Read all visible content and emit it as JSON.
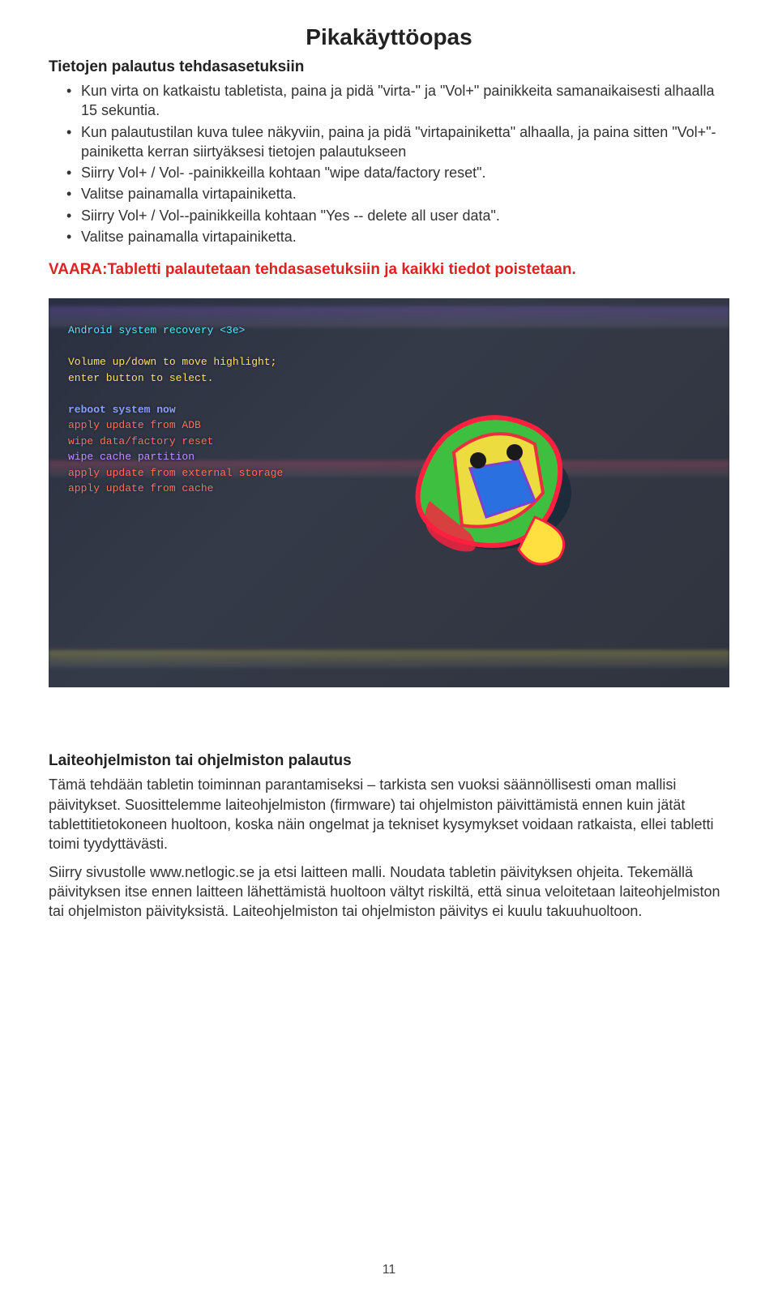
{
  "title": "Pikakäyttöopas",
  "section1": {
    "heading": "Tietojen palautus tehdasasetuksiin",
    "items": [
      "Kun virta on katkaistu tabletista, paina ja pidä \"virta-\" ja \"Vol+\" painikkeita samanaikaisesti alhaalla 15 sekuntia.",
      "Kun palautustilan kuva tulee näkyviin, paina ja pidä \"virtapainiketta\" alhaalla, ja paina sitten \"Vol+\"-painiketta kerran siirtyäksesi tietojen palautukseen",
      "Siirry Vol+ / Vol- -painikkeilla kohtaan \"wipe data/factory reset\".",
      "Valitse painamalla virtapainiketta.",
      "Siirry Vol+ / Vol--painikkeilla kohtaan \"Yes -- delete all user data\".",
      "Valitse painamalla virtapainiketta."
    ]
  },
  "warning": "VAARA:Tabletti palautetaan tehdasasetuksiin ja kaikki tiedot poistetaan.",
  "recovery_screen": {
    "header": "Android system recovery <3e>",
    "hint1": "Volume up/down to move highlight;",
    "hint2": "enter button to select.",
    "menu": [
      "reboot system now",
      "apply update from ADB",
      "wipe data/factory reset",
      "wipe cache partition",
      "apply update from external storage",
      "apply update from cache"
    ]
  },
  "section2": {
    "heading": "Laiteohjelmiston tai ohjelmiston palautus",
    "p1": "Tämä tehdään tabletin toiminnan parantamiseksi – tarkista sen vuoksi säännöllisesti oman mallisi päivitykset. Suosittelemme laiteohjelmiston (firmware) tai ohjelmiston päivittämistä ennen kuin jätät tablettitietokoneen huoltoon, koska näin ongelmat ja tekniset kysymykset voidaan ratkaista, ellei tabletti toimi tyydyttävästi.",
    "p2": "Siirry sivustolle www.netlogic.se ja etsi laitteen malli. Noudata tabletin päivityksen ohjeita. Tekemällä päivityksen itse ennen laitteen lähettämistä huoltoon vältyt riskiltä, että sinua veloitetaan laiteohjelmiston tai ohjelmiston päivityksistä. Laiteohjelmiston tai ohjelmiston päivitys ei kuulu takuuhuoltoon."
  },
  "page_number": "11"
}
